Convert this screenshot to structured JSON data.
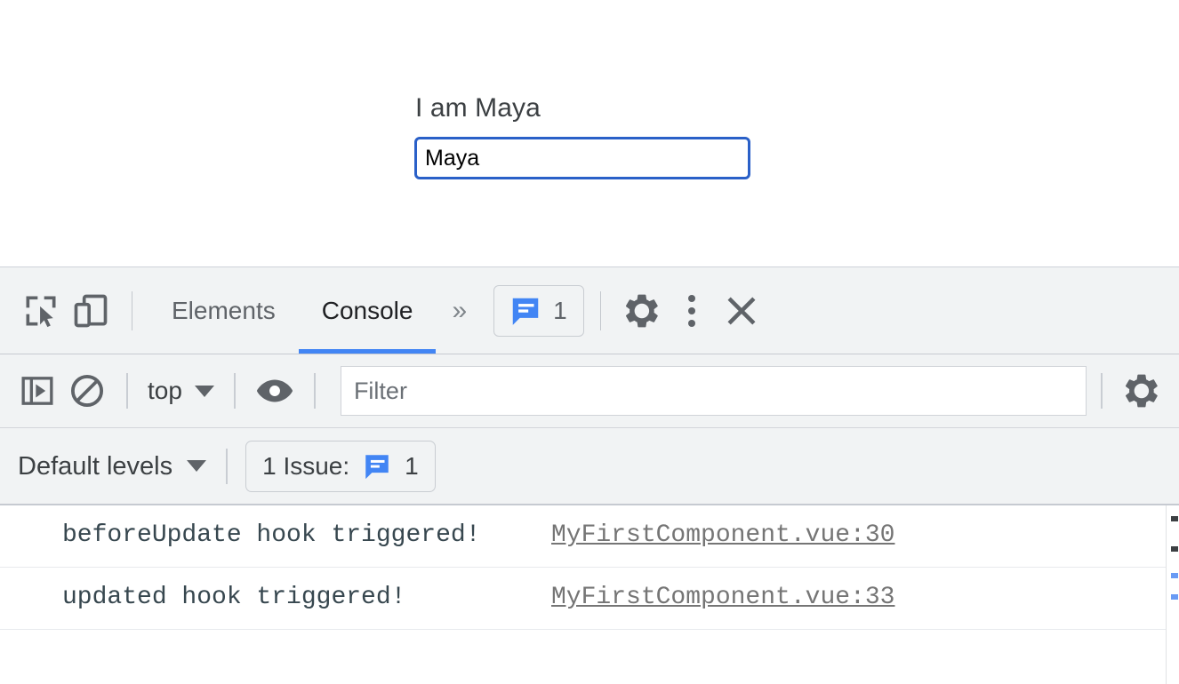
{
  "page": {
    "heading": "I am Maya",
    "name_input": {
      "value": "Maya",
      "placeholder": ""
    }
  },
  "devtools": {
    "toolbar": {
      "inspect_icon": "inspect-element-icon",
      "device_icon": "device-toolbar-icon",
      "tabs": [
        {
          "label": "Elements",
          "active": false
        },
        {
          "label": "Console",
          "active": true
        }
      ],
      "more_tabs_label": "»",
      "issues_badge": {
        "icon": "issue-message-icon",
        "count": "1"
      },
      "settings_icon": "gear-icon",
      "kebab_icon": "more-options-icon",
      "close_icon": "close-icon"
    },
    "filterbar": {
      "sidebar_toggle_icon": "console-sidebar-icon",
      "clear_icon": "clear-console-icon",
      "context": {
        "label": "top"
      },
      "eye_icon": "live-expression-eye-icon",
      "filter": {
        "value": "",
        "placeholder": "Filter"
      },
      "settings_icon": "console-settings-gear-icon"
    },
    "levelbar": {
      "levels": {
        "label": "Default levels"
      },
      "issue_pill": {
        "text": "1 Issue:",
        "icon": "issue-message-icon",
        "count": "1"
      }
    },
    "console_messages": [
      {
        "text": "beforeUpdate hook triggered!",
        "source": "MyFirstComponent.vue:30"
      },
      {
        "text": "updated hook triggered!",
        "source": "MyFirstComponent.vue:33"
      }
    ]
  },
  "colors": {
    "accent_blue": "#4285f4",
    "focus_border": "#2a60c8",
    "toolbar_bg": "#f1f3f4",
    "message_text": "#37474f",
    "source_link": "#757575"
  }
}
